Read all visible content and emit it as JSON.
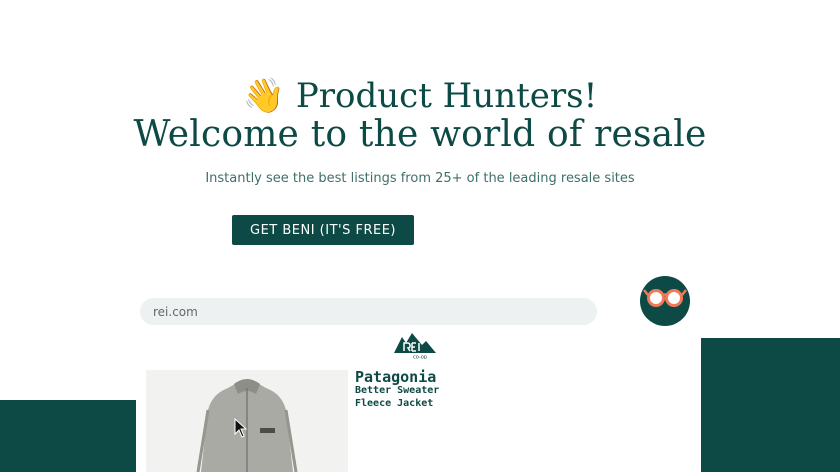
{
  "hero": {
    "wave_emoji": "👋",
    "title_line1": "Product Hunters!",
    "title_line2": "Welcome to the world of resale",
    "subtitle": "Instantly see the best listings from 25+ of the leading resale sites"
  },
  "cta": {
    "label": "GET BENI (IT'S FREE)"
  },
  "demo": {
    "url": "rei.com",
    "store_logo": "REI co-op",
    "product": {
      "brand": "Patagonia",
      "name": "Better Sweater Fleece Jacket"
    }
  },
  "icons": {
    "avatar": "glasses-icon",
    "logo": "rei-logo-icon",
    "cursor": "mouse-pointer-icon"
  },
  "colors": {
    "brand_dark": "#0d4a45",
    "accent_glasses": "#f07a5a",
    "url_bar_bg": "#eef1f1"
  }
}
